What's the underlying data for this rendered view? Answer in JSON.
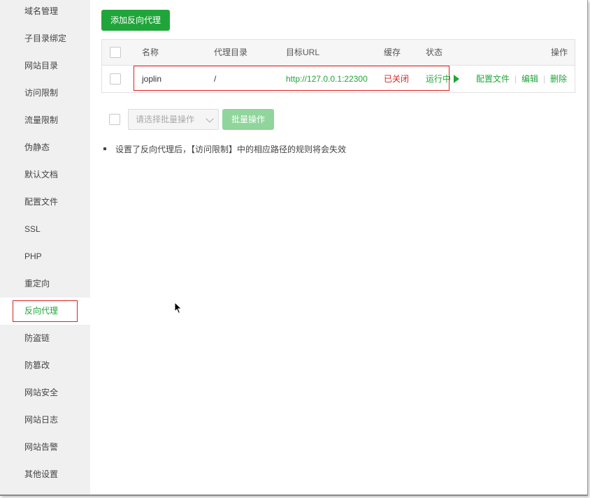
{
  "sidebar": {
    "items": [
      {
        "label": "域名管理"
      },
      {
        "label": "子目录绑定"
      },
      {
        "label": "网站目录"
      },
      {
        "label": "访问限制"
      },
      {
        "label": "流量限制"
      },
      {
        "label": "伪静态"
      },
      {
        "label": "默认文档"
      },
      {
        "label": "配置文件"
      },
      {
        "label": "SSL"
      },
      {
        "label": "PHP"
      },
      {
        "label": "重定向"
      },
      {
        "label": "反向代理"
      },
      {
        "label": "防盗链"
      },
      {
        "label": "防篡改"
      },
      {
        "label": "网站安全"
      },
      {
        "label": "网站日志"
      },
      {
        "label": "网站告警"
      },
      {
        "label": "其他设置"
      }
    ],
    "active": "反向代理"
  },
  "toolbar": {
    "add_label": "添加反向代理"
  },
  "table": {
    "headers": {
      "name": "名称",
      "dir": "代理目录",
      "url": "目标URL",
      "cache": "缓存",
      "status": "状态",
      "ops": "操作"
    },
    "rows": [
      {
        "name": "joplin",
        "dir": "/",
        "url": "http://127.0.0.1:22300",
        "cache": "已关闭",
        "status": "运行中",
        "ops": [
          "配置文件",
          "编辑",
          "删除"
        ]
      }
    ]
  },
  "batch": {
    "placeholder": "请选择批量操作",
    "button_label": "批量操作"
  },
  "tips": [
    "设置了反向代理后，【访问限制】中的相应路径的规则将会失效"
  ],
  "colors": {
    "accent": "#20a53a",
    "danger": "#e02020"
  }
}
